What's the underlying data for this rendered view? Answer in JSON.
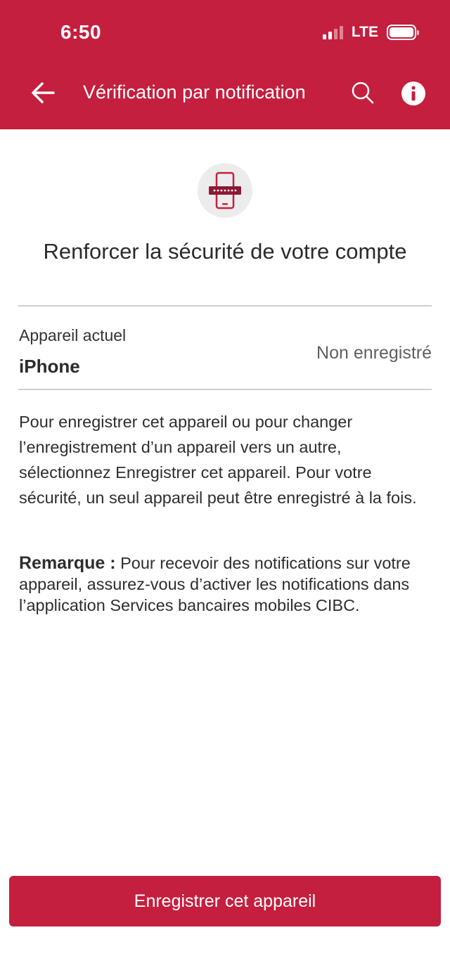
{
  "status_bar": {
    "time": "6:50",
    "network": "LTE"
  },
  "header": {
    "title": "Vérification par notification"
  },
  "main": {
    "headline": "Renforcer la sécurité de votre compte",
    "device": {
      "label": "Appareil actuel",
      "name": "iPhone",
      "status": "Non enregistré"
    },
    "description": "Pour enregistrer cet appareil ou pour changer l’enregistrement d’un appareil vers un autre, sélectionnez Enregistrer cet appareil. Pour votre sécurité, un seul appareil peut être enregistré à la fois.",
    "note": {
      "label": "Remarque :",
      "text": " Pour recevoir des notifications sur votre appareil, assurez-vous d’activer les notifications dans l’application Services bancaires mobiles CIBC."
    }
  },
  "footer": {
    "button_label": "Enregistrer cet appareil"
  },
  "icons": [
    "back-arrow-icon",
    "search-icon",
    "info-icon",
    "phone-password-icon"
  ],
  "colors": {
    "brand": "#c41f3e",
    "badge_bg": "#ececec",
    "divider": "#cfcfcf"
  }
}
